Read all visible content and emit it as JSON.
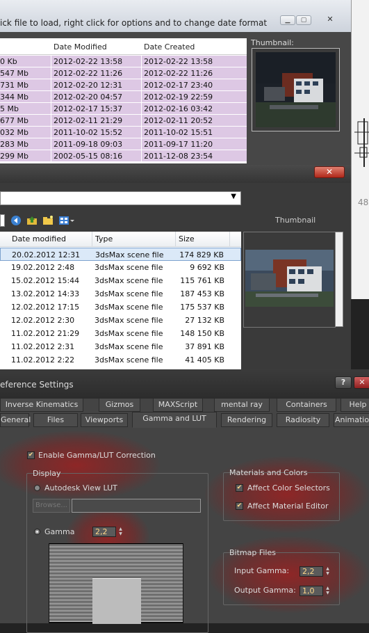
{
  "window1": {
    "title": "ick file to load, right click for options and to change date format",
    "columns": [
      "Date Modified",
      "Date Created"
    ],
    "rows": [
      {
        "size": "0 Kb",
        "modified": "2012-02-22 13:58",
        "created": "2012-02-22 13:58"
      },
      {
        "size": "547 Mb",
        "modified": "2012-02-22 11:26",
        "created": "2012-02-22 11:26"
      },
      {
        "size": "731 Mb",
        "modified": "2012-02-20 12:31",
        "created": "2012-02-17 23:40"
      },
      {
        "size": "344 Mb",
        "modified": "2012-02-20 04:57",
        "created": "2012-02-19 22:59"
      },
      {
        "size": "5 Mb",
        "modified": "2012-02-17 15:37",
        "created": "2012-02-16 03:42"
      },
      {
        "size": "677 Mb",
        "modified": "2012-02-11 21:29",
        "created": "2012-02-11 20:52"
      },
      {
        "size": "032 Mb",
        "modified": "2011-10-02 15:52",
        "created": "2011-10-02 15:51"
      },
      {
        "size": "283 Mb",
        "modified": "2011-09-18 09:03",
        "created": "2011-09-17 11:20"
      },
      {
        "size": "299 Mb",
        "modified": "2002-05-15 08:16",
        "created": "2011-12-08 23:54"
      }
    ],
    "thumbnail_label": "Thumbnail:",
    "side_value": "48"
  },
  "window2": {
    "close_label": "✕",
    "columns": [
      "Date modified",
      "Type",
      "Size"
    ],
    "thumbnail_label": "Thumbnail",
    "rows": [
      {
        "modified": "20.02.2012 12:31",
        "type": "3dsMax scene file",
        "size": "174 829 KB"
      },
      {
        "modified": "19.02.2012 2:48",
        "type": "3dsMax scene file",
        "size": "9 692 KB"
      },
      {
        "modified": "15.02.2012 15:44",
        "type": "3dsMax scene file",
        "size": "115 761 KB"
      },
      {
        "modified": "13.02.2012 14:33",
        "type": "3dsMax scene file",
        "size": "187 453 KB"
      },
      {
        "modified": "12.02.2012 17:15",
        "type": "3dsMax scene file",
        "size": "175 537 KB"
      },
      {
        "modified": "12.02.2012 2:30",
        "type": "3dsMax scene file",
        "size": "27 132 KB"
      },
      {
        "modified": "11.02.2012 21:29",
        "type": "3dsMax scene file",
        "size": "148 150 KB"
      },
      {
        "modified": "11.02.2012 2:31",
        "type": "3dsMax scene file",
        "size": "37 891 KB"
      },
      {
        "modified": "11.02.2012 2:22",
        "type": "3dsMax scene file",
        "size": "41 405 KB"
      }
    ],
    "selected_row": 0
  },
  "window3": {
    "title": "eference Settings",
    "help_label": "?",
    "close_label": "✕",
    "tabs_row1": [
      "Inverse Kinematics",
      "Gizmos",
      "MAXScript",
      "mental ray",
      "Containers",
      "Help"
    ],
    "tabs_row2": [
      "General",
      "Files",
      "Viewports",
      "Gamma and LUT",
      "Rendering",
      "Radiosity",
      "Animation"
    ],
    "active_tab": "Gamma and LUT",
    "enable_gamma": {
      "label": "Enable Gamma/LUT Correction",
      "checked": true
    },
    "display": {
      "group_label": "Display",
      "lut_label": "Autodesk View LUT",
      "browse_label": "Browse...",
      "browse_value": "",
      "gamma_label": "Gamma",
      "gamma_value": "2,2"
    },
    "materials": {
      "group_label": "Materials and Colors",
      "affect_color_selectors": "Affect Color Selectors",
      "affect_material_editor": "Affect Material Editor"
    },
    "bitmap": {
      "group_label": "Bitmap Files",
      "input_label": "Input Gamma:",
      "input_value": "2,2",
      "output_label": "Output Gamma:",
      "output_value": "1,0"
    }
  },
  "colors": {
    "row_highlight": "#ddc8e4",
    "selection": "#dbe9f8",
    "glow": "#962323",
    "close_red": "#c0392b"
  }
}
